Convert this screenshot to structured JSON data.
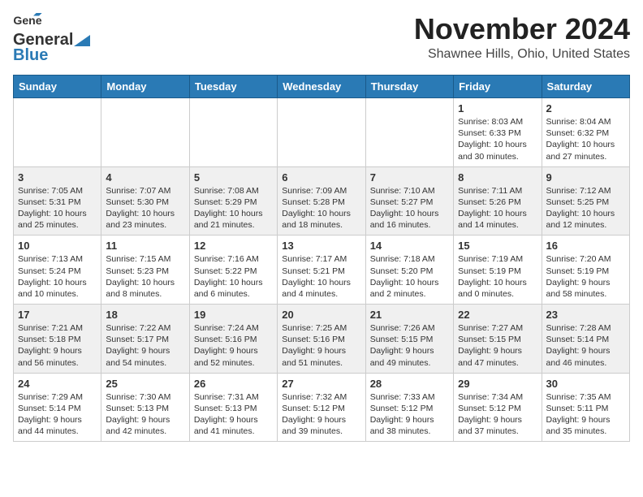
{
  "header": {
    "logo_line1": "General",
    "logo_line2": "Blue",
    "month": "November 2024",
    "location": "Shawnee Hills, Ohio, United States"
  },
  "weekdays": [
    "Sunday",
    "Monday",
    "Tuesday",
    "Wednesday",
    "Thursday",
    "Friday",
    "Saturday"
  ],
  "weeks": [
    [
      {
        "day": "",
        "content": ""
      },
      {
        "day": "",
        "content": ""
      },
      {
        "day": "",
        "content": ""
      },
      {
        "day": "",
        "content": ""
      },
      {
        "day": "",
        "content": ""
      },
      {
        "day": "1",
        "content": "Sunrise: 8:03 AM\nSunset: 6:33 PM\nDaylight: 10 hours and 30 minutes."
      },
      {
        "day": "2",
        "content": "Sunrise: 8:04 AM\nSunset: 6:32 PM\nDaylight: 10 hours and 27 minutes."
      }
    ],
    [
      {
        "day": "3",
        "content": "Sunrise: 7:05 AM\nSunset: 5:31 PM\nDaylight: 10 hours and 25 minutes."
      },
      {
        "day": "4",
        "content": "Sunrise: 7:07 AM\nSunset: 5:30 PM\nDaylight: 10 hours and 23 minutes."
      },
      {
        "day": "5",
        "content": "Sunrise: 7:08 AM\nSunset: 5:29 PM\nDaylight: 10 hours and 21 minutes."
      },
      {
        "day": "6",
        "content": "Sunrise: 7:09 AM\nSunset: 5:28 PM\nDaylight: 10 hours and 18 minutes."
      },
      {
        "day": "7",
        "content": "Sunrise: 7:10 AM\nSunset: 5:27 PM\nDaylight: 10 hours and 16 minutes."
      },
      {
        "day": "8",
        "content": "Sunrise: 7:11 AM\nSunset: 5:26 PM\nDaylight: 10 hours and 14 minutes."
      },
      {
        "day": "9",
        "content": "Sunrise: 7:12 AM\nSunset: 5:25 PM\nDaylight: 10 hours and 12 minutes."
      }
    ],
    [
      {
        "day": "10",
        "content": "Sunrise: 7:13 AM\nSunset: 5:24 PM\nDaylight: 10 hours and 10 minutes."
      },
      {
        "day": "11",
        "content": "Sunrise: 7:15 AM\nSunset: 5:23 PM\nDaylight: 10 hours and 8 minutes."
      },
      {
        "day": "12",
        "content": "Sunrise: 7:16 AM\nSunset: 5:22 PM\nDaylight: 10 hours and 6 minutes."
      },
      {
        "day": "13",
        "content": "Sunrise: 7:17 AM\nSunset: 5:21 PM\nDaylight: 10 hours and 4 minutes."
      },
      {
        "day": "14",
        "content": "Sunrise: 7:18 AM\nSunset: 5:20 PM\nDaylight: 10 hours and 2 minutes."
      },
      {
        "day": "15",
        "content": "Sunrise: 7:19 AM\nSunset: 5:19 PM\nDaylight: 10 hours and 0 minutes."
      },
      {
        "day": "16",
        "content": "Sunrise: 7:20 AM\nSunset: 5:19 PM\nDaylight: 9 hours and 58 minutes."
      }
    ],
    [
      {
        "day": "17",
        "content": "Sunrise: 7:21 AM\nSunset: 5:18 PM\nDaylight: 9 hours and 56 minutes."
      },
      {
        "day": "18",
        "content": "Sunrise: 7:22 AM\nSunset: 5:17 PM\nDaylight: 9 hours and 54 minutes."
      },
      {
        "day": "19",
        "content": "Sunrise: 7:24 AM\nSunset: 5:16 PM\nDaylight: 9 hours and 52 minutes."
      },
      {
        "day": "20",
        "content": "Sunrise: 7:25 AM\nSunset: 5:16 PM\nDaylight: 9 hours and 51 minutes."
      },
      {
        "day": "21",
        "content": "Sunrise: 7:26 AM\nSunset: 5:15 PM\nDaylight: 9 hours and 49 minutes."
      },
      {
        "day": "22",
        "content": "Sunrise: 7:27 AM\nSunset: 5:15 PM\nDaylight: 9 hours and 47 minutes."
      },
      {
        "day": "23",
        "content": "Sunrise: 7:28 AM\nSunset: 5:14 PM\nDaylight: 9 hours and 46 minutes."
      }
    ],
    [
      {
        "day": "24",
        "content": "Sunrise: 7:29 AM\nSunset: 5:14 PM\nDaylight: 9 hours and 44 minutes."
      },
      {
        "day": "25",
        "content": "Sunrise: 7:30 AM\nSunset: 5:13 PM\nDaylight: 9 hours and 42 minutes."
      },
      {
        "day": "26",
        "content": "Sunrise: 7:31 AM\nSunset: 5:13 PM\nDaylight: 9 hours and 41 minutes."
      },
      {
        "day": "27",
        "content": "Sunrise: 7:32 AM\nSunset: 5:12 PM\nDaylight: 9 hours and 39 minutes."
      },
      {
        "day": "28",
        "content": "Sunrise: 7:33 AM\nSunset: 5:12 PM\nDaylight: 9 hours and 38 minutes."
      },
      {
        "day": "29",
        "content": "Sunrise: 7:34 AM\nSunset: 5:12 PM\nDaylight: 9 hours and 37 minutes."
      },
      {
        "day": "30",
        "content": "Sunrise: 7:35 AM\nSunset: 5:11 PM\nDaylight: 9 hours and 35 minutes."
      }
    ]
  ]
}
